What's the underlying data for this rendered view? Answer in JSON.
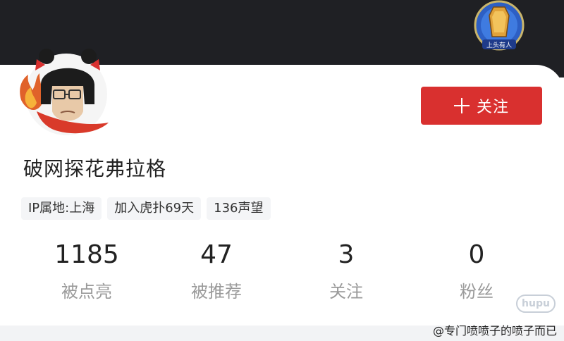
{
  "badge": {
    "text": "上头有人"
  },
  "profile": {
    "username": "破网探花弗拉格",
    "tags": [
      "IP属地:上海",
      "加入虎扑69天",
      "136声望"
    ]
  },
  "follow_button": {
    "label": "关注"
  },
  "stats": [
    {
      "value": "1185",
      "label": "被点亮"
    },
    {
      "value": "47",
      "label": "被推荐"
    },
    {
      "value": "3",
      "label": "关注"
    },
    {
      "value": "0",
      "label": "粉丝"
    }
  ],
  "watermark": {
    "text": "@专门喷喷子的喷子而已",
    "logo_text": "hupu"
  },
  "colors": {
    "accent": "#d9302f",
    "header_bg": "#1f2024"
  }
}
